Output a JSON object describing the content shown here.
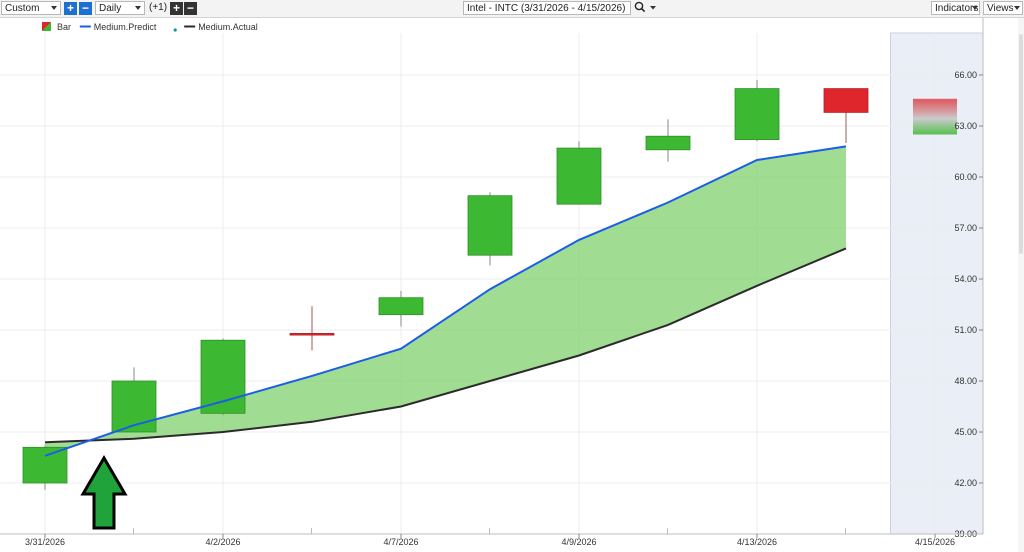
{
  "toolbar": {
    "range_select": "Custom",
    "interval_select": "Daily",
    "offset_label": "(+1)",
    "symbol_title": "Intel - INTC (3/31/2026 - 4/15/2026)",
    "indicators_label": "Indicators",
    "views_label": "Views",
    "plus_glyph": "+",
    "minus_glyph": "−"
  },
  "colors": {
    "up_candle": "#3db832",
    "down_candle": "#e0262d",
    "predict_line": "#1a5ee8",
    "actual_line": "#2b2b2b",
    "fill_between": "#8fd67f",
    "forecast_band": "#e9eef7",
    "arrow_fill": "#1fa33a"
  },
  "chart_data": {
    "type": "candlestick",
    "title": "Intel - INTC (3/31/2026 - 4/15/2026)",
    "ylim": [
      39,
      67
    ],
    "y_ticks": [
      "39.00",
      "42.00",
      "45.00",
      "48.00",
      "51.00",
      "54.00",
      "57.00",
      "60.00",
      "63.00",
      "66.00"
    ],
    "x_tick_labels": [
      {
        "index": 0,
        "label": "3/31/2026"
      },
      {
        "index": 2,
        "label": "4/2/2026"
      },
      {
        "index": 4,
        "label": "4/7/2026"
      },
      {
        "index": 6,
        "label": "4/9/2026"
      },
      {
        "index": 8,
        "label": "4/13/2026"
      },
      {
        "index": 10,
        "label": "4/15/2026"
      }
    ],
    "legend": [
      {
        "name": "Bar",
        "kind": "candle"
      },
      {
        "name": "Medium.Predict",
        "kind": "line",
        "color": "#1a5ee8"
      },
      {
        "name": "Medium.Actual",
        "kind": "line",
        "color": "#2b2b2b"
      }
    ],
    "candles": [
      {
        "open": 42.0,
        "high": 44.2,
        "low": 41.6,
        "close": 44.1
      },
      {
        "open": 45.0,
        "high": 48.8,
        "low": 45.0,
        "close": 48.0
      },
      {
        "open": 46.1,
        "high": 50.5,
        "low": 46.0,
        "close": 50.4
      },
      {
        "open": 50.8,
        "high": 52.4,
        "low": 49.8,
        "close": 50.7
      },
      {
        "open": 51.9,
        "high": 53.3,
        "low": 51.2,
        "close": 52.9
      },
      {
        "open": 55.4,
        "high": 59.1,
        "low": 54.8,
        "close": 58.9
      },
      {
        "open": 58.4,
        "high": 62.1,
        "low": 58.4,
        "close": 61.7
      },
      {
        "open": 61.6,
        "high": 63.4,
        "low": 60.9,
        "close": 62.4
      },
      {
        "open": 62.2,
        "high": 65.7,
        "low": 62.1,
        "close": 65.2
      },
      {
        "open": 65.2,
        "high": 65.2,
        "low": 62.0,
        "close": 63.8
      }
    ],
    "forecast_bar": {
      "index": 10,
      "high": 64.6,
      "low": 62.5
    },
    "series": [
      {
        "name": "Medium.Predict",
        "values": [
          43.6,
          45.4,
          46.8,
          48.3,
          49.9,
          53.4,
          56.3,
          58.5,
          61.0,
          61.8
        ]
      },
      {
        "name": "Medium.Actual",
        "values": [
          44.4,
          44.6,
          45.0,
          45.6,
          46.5,
          48.0,
          49.5,
          51.3,
          53.6,
          55.8
        ]
      }
    ],
    "signal": {
      "index": 1,
      "direction": "up"
    }
  }
}
